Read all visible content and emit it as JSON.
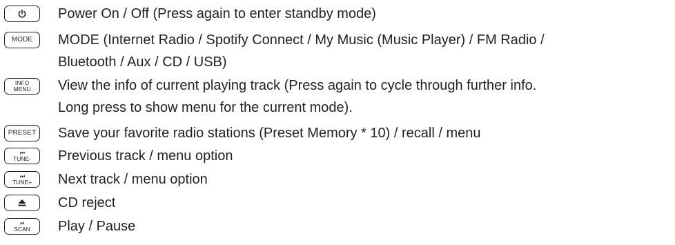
{
  "entries": [
    {
      "button": {
        "icon": "power-icon"
      },
      "lines": [
        "Power On / Off (Press again to enter standby mode)"
      ]
    },
    {
      "button": {
        "label": "MODE"
      },
      "lines": [
        "MODE (Internet Radio / Spotify Connect / My Music (Music Player) / FM Radio  /",
        "Bluetooth / Aux / CD / USB)"
      ]
    },
    {
      "button": {
        "label_top": "INFO",
        "label_bottom": "MENU"
      },
      "lines": [
        "View the info of current playing track (Press again to cycle through further info.",
        "Long press to show menu for the current mode)."
      ]
    },
    {
      "button": {
        "label": "PRESET"
      },
      "lines": [
        "Save your favorite radio stations (Preset Memory * 10) / recall / menu"
      ]
    },
    {
      "button": {
        "glyph": "⏮",
        "label": "TUNE-",
        "icon": "previous-track-icon"
      },
      "lines": [
        "Previous track / menu option"
      ]
    },
    {
      "button": {
        "glyph": "⏭",
        "label": "TUNE+",
        "icon": "next-track-icon"
      },
      "lines": [
        "Next track / menu option"
      ]
    },
    {
      "button": {
        "icon": "eject-icon"
      },
      "lines": [
        "CD reject"
      ]
    },
    {
      "button": {
        "glyph": "⏯",
        "label": "SCAN",
        "icon": "play-pause-icon"
      },
      "lines": [
        "Play / Pause"
      ]
    }
  ],
  "colors": {
    "ink": "#231f20",
    "background": "#ffffff"
  }
}
